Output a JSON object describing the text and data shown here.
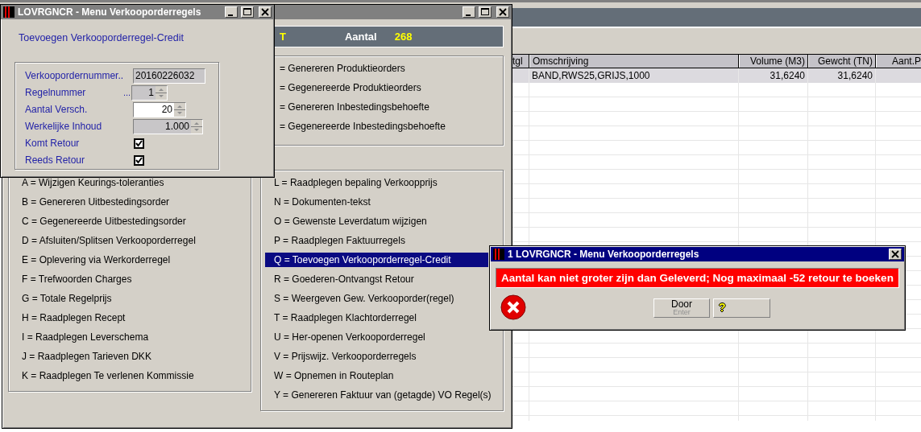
{
  "background_window": {
    "table": {
      "columns": [
        "tgl",
        "Omschrijving",
        "Volume (M3)",
        "Gewcht (TN)",
        "Aant.P"
      ],
      "rows": [
        {
          "selected": true,
          "omschrijving": "BAND,RWS25,GRIJS,1000",
          "volume": "31,6240",
          "gewicht": "31,6240"
        }
      ]
    }
  },
  "menu_window": {
    "header": {
      "partial_label": "T",
      "label": "Aantal",
      "value": "268"
    },
    "top_options": [
      {
        "label": "= Genereren Produktieorders",
        "selected": false
      },
      {
        "label": "= Gegenereerde Produktieorders",
        "selected": false
      },
      {
        "label": "= Genereren Inbestedingsbehoefte",
        "selected": false
      },
      {
        "label": "= Gegenereerde Inbestedingsbehoefte",
        "selected": false
      }
    ],
    "left_options": [
      {
        "label": "A = Wijzigen Keurings-toleranties",
        "selected": false
      },
      {
        "label": "B = Genereren Uitbestedingsorder",
        "selected": false
      },
      {
        "label": "C = Gegenereerde Uitbestedingsorder",
        "selected": false
      },
      {
        "label": "D = Afsluiten/Splitsen Verkooporderregel",
        "selected": false
      },
      {
        "label": "E = Oplevering via Werkorderregel",
        "selected": false
      },
      {
        "label": "F = Trefwoorden Charges",
        "selected": false
      },
      {
        "label": "G = Totale Regelprijs",
        "selected": false
      },
      {
        "label": "H = Raadplegen Recept",
        "selected": false
      },
      {
        "label": "I = Raadplegen Leverschema",
        "selected": false
      },
      {
        "label": "J = Raadplegen Tarieven DKK",
        "selected": false
      },
      {
        "label": "K = Raadplegen Te verlenen Kommissie",
        "selected": false
      }
    ],
    "right_options": [
      {
        "label": "L = Raadplegen bepaling Verkoopprijs",
        "selected": false
      },
      {
        "label": "N = Dokumenten-tekst",
        "selected": false
      },
      {
        "label": "O = Gewenste Leverdatum wijzigen",
        "selected": false
      },
      {
        "label": "P = Raadplegen Faktuurregels",
        "selected": false
      },
      {
        "label": "Q = Toevoegen Verkooporderregel-Credit",
        "selected": true
      },
      {
        "label": "R = Goederen-Ontvangst Retour",
        "selected": false
      },
      {
        "label": "S = Weergeven Gew. Verkooporder(regel)",
        "selected": false
      },
      {
        "label": "T = Raadplegen Klachtorderregel",
        "selected": false
      },
      {
        "label": "U = Her-openen Verkooporderregel",
        "selected": false
      },
      {
        "label": "V = Prijswijz. Verkooporderregels",
        "selected": false
      },
      {
        "label": "W = Opnemen in Routeplan",
        "selected": false
      },
      {
        "label": "Y = Genereren Faktuur van (getagde) VO Regel(s)",
        "selected": false
      }
    ]
  },
  "dialog": {
    "title": "LOVRGNCR - Menu Verkooporderregels",
    "heading": "Toevoegen Verkooporderregel-Credit",
    "fields": [
      {
        "kind": "text",
        "label": "Verkoopordernummer..",
        "value": "20160226032",
        "disabled": true
      },
      {
        "kind": "spin",
        "label": "Regelnummer",
        "suffix": "...",
        "value": "1",
        "disabled": true
      },
      {
        "kind": "spin",
        "label": "Aantal Versch.",
        "value": "20",
        "disabled": false
      },
      {
        "kind": "spin",
        "label": "Werkelijke Inhoud",
        "value": "1.000",
        "disabled": true
      },
      {
        "kind": "checkbox",
        "label": "Komt Retour",
        "checked": true
      },
      {
        "kind": "checkbox",
        "label": "Reeds Retour",
        "checked": true
      }
    ]
  },
  "error_dialog": {
    "title": "1 LOVRGNCR - Menu Verkooporderregels",
    "message": "Aantal kan niet groter zijn dan Geleverd; Nog maximaal -52 retour te boeken",
    "buttons": [
      {
        "kind": "door",
        "label": "Door",
        "shortcut": "Enter"
      },
      {
        "kind": "help",
        "label": "?"
      }
    ]
  }
}
